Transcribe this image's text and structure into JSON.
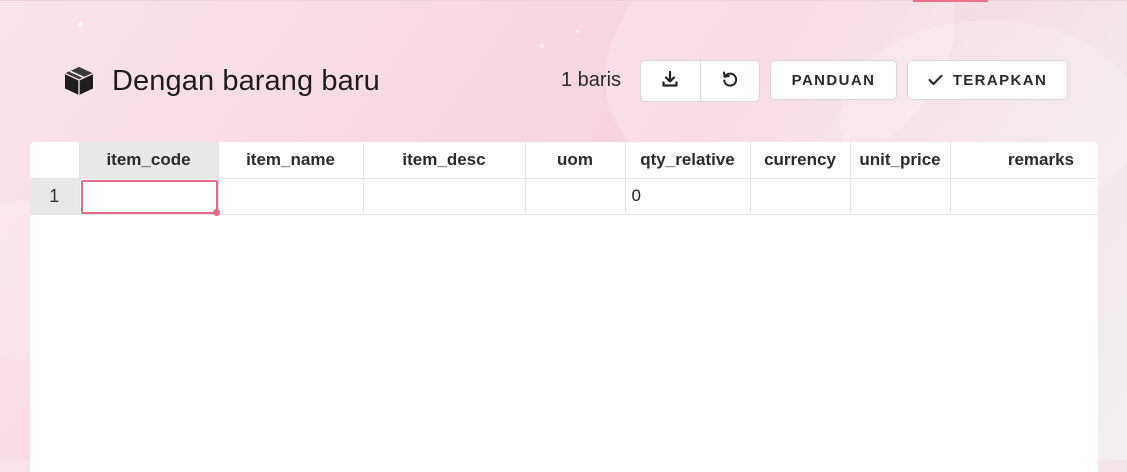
{
  "header": {
    "title": "Dengan barang baru",
    "title_icon": "package-icon",
    "row_count": "1 baris",
    "download_icon": "download-icon",
    "reset_icon": "undo-icon",
    "guide_label": "PANDUAN",
    "apply_label": "TERAPKAN",
    "apply_icon": "check-icon"
  },
  "grid": {
    "columns": [
      "item_code",
      "item_name",
      "item_desc",
      "uom",
      "qty_relative",
      "currency",
      "unit_price",
      "remarks"
    ],
    "rows": [
      {
        "row_number": "1",
        "cells": [
          "",
          "",
          "",
          "",
          "0",
          "",
          "",
          ""
        ]
      }
    ],
    "selected_cell": "item_code"
  },
  "colors": {
    "accent": "#e16b86",
    "header_selected_bg": "#e8e8e8"
  }
}
